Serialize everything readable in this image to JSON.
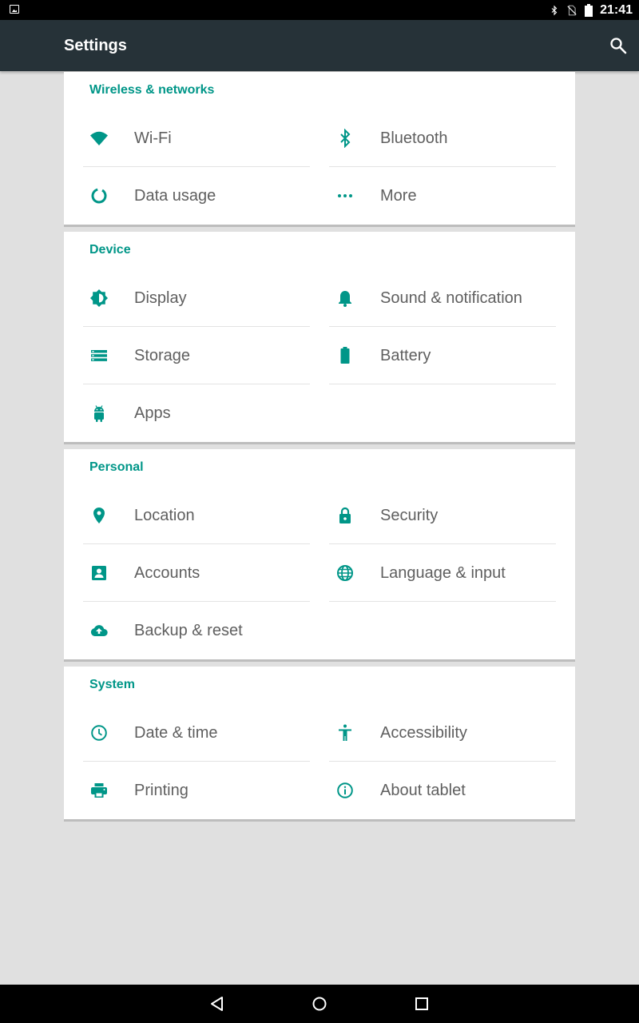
{
  "status_bar": {
    "time": "21:41"
  },
  "app_bar": {
    "title": "Settings"
  },
  "colors": {
    "accent": "#009688",
    "app_bar": "#263238",
    "background": "#e0e0e0",
    "text": "#5f5f5f"
  },
  "sections": [
    {
      "title": "Wireless & networks",
      "items": [
        {
          "label": "Wi-Fi",
          "icon": "wifi-icon"
        },
        {
          "label": "Bluetooth",
          "icon": "bluetooth-icon"
        },
        {
          "label": "Data usage",
          "icon": "data-usage-icon"
        },
        {
          "label": "More",
          "icon": "more-icon"
        }
      ]
    },
    {
      "title": "Device",
      "items": [
        {
          "label": "Display",
          "icon": "display-brightness-icon"
        },
        {
          "label": "Sound & notification",
          "icon": "bell-icon"
        },
        {
          "label": "Storage",
          "icon": "storage-icon"
        },
        {
          "label": "Battery",
          "icon": "battery-icon"
        },
        {
          "label": "Apps",
          "icon": "android-icon"
        }
      ]
    },
    {
      "title": "Personal",
      "items": [
        {
          "label": "Location",
          "icon": "location-pin-icon"
        },
        {
          "label": "Security",
          "icon": "lock-icon"
        },
        {
          "label": "Accounts",
          "icon": "account-box-icon"
        },
        {
          "label": "Language & input",
          "icon": "globe-icon"
        },
        {
          "label": "Backup & reset",
          "icon": "cloud-upload-icon"
        }
      ]
    },
    {
      "title": "System",
      "items": [
        {
          "label": "Date & time",
          "icon": "clock-icon"
        },
        {
          "label": "Accessibility",
          "icon": "accessibility-icon"
        },
        {
          "label": "Printing",
          "icon": "printer-icon"
        },
        {
          "label": "About tablet",
          "icon": "info-icon"
        }
      ]
    }
  ],
  "nav_bar": {
    "buttons": [
      "back-button",
      "home-button",
      "recents-button"
    ]
  }
}
